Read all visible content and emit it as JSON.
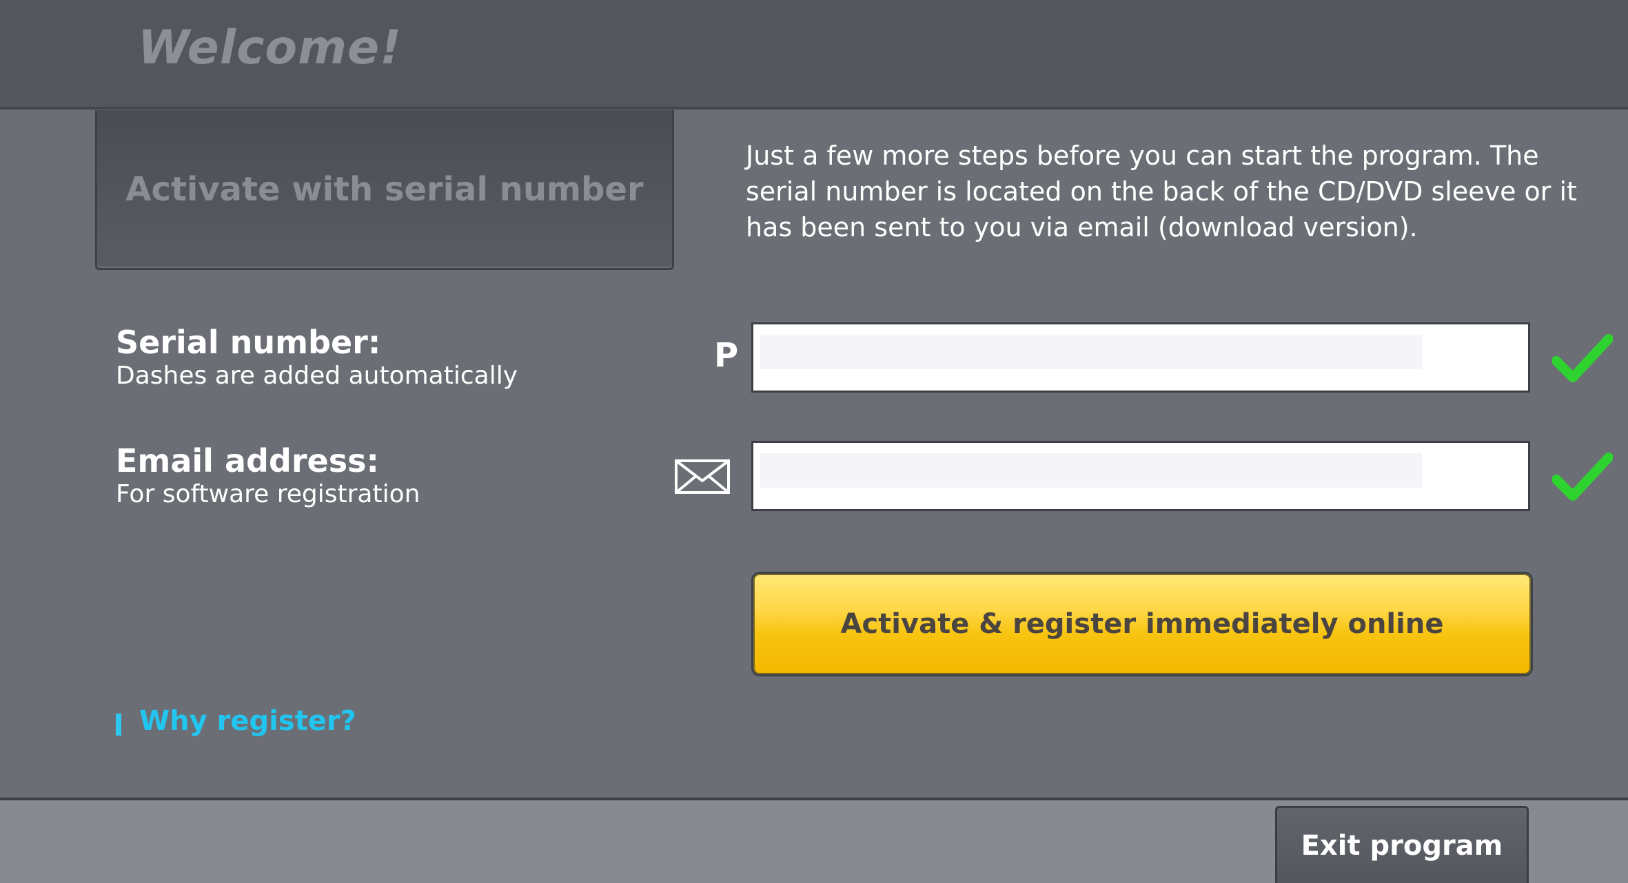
{
  "header": {
    "title": "Welcome!"
  },
  "tab": {
    "label": "Activate with serial number"
  },
  "intro": {
    "text": "Just a few more steps before you can start the program. The serial number is located on the back of the CD/DVD sleeve or it has been sent to you via email (download version)."
  },
  "serial": {
    "title": "Serial number:",
    "subtitle": "Dashes are added automatically",
    "prefix": "P",
    "value": "",
    "valid": true
  },
  "email": {
    "title": "Email address:",
    "subtitle": "For software registration",
    "value": "",
    "valid": true
  },
  "actions": {
    "primary_label": "Activate & register immediately online",
    "why_register_label": "Why register?",
    "exit_label": "Exit program"
  },
  "colors": {
    "accent_yellow": "#f8c410",
    "link_blue": "#22c5f0",
    "check_green": "#2fd32f"
  },
  "icons": {
    "serial_prefix": "p-letter-icon",
    "email": "envelope-icon",
    "valid": "checkmark-icon"
  }
}
